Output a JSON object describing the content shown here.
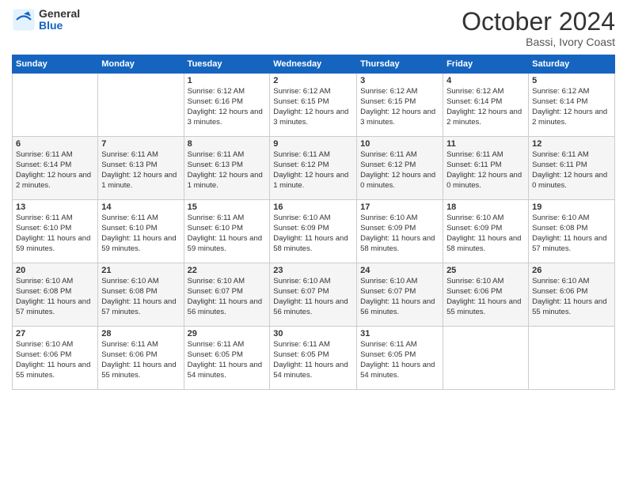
{
  "header": {
    "logo_general": "General",
    "logo_blue": "Blue",
    "title": "October 2024",
    "location": "Bassi, Ivory Coast"
  },
  "days_of_week": [
    "Sunday",
    "Monday",
    "Tuesday",
    "Wednesday",
    "Thursday",
    "Friday",
    "Saturday"
  ],
  "weeks": [
    [
      {
        "day": "",
        "info": ""
      },
      {
        "day": "",
        "info": ""
      },
      {
        "day": "1",
        "info": "Sunrise: 6:12 AM\nSunset: 6:16 PM\nDaylight: 12 hours and 3 minutes."
      },
      {
        "day": "2",
        "info": "Sunrise: 6:12 AM\nSunset: 6:15 PM\nDaylight: 12 hours and 3 minutes."
      },
      {
        "day": "3",
        "info": "Sunrise: 6:12 AM\nSunset: 6:15 PM\nDaylight: 12 hours and 3 minutes."
      },
      {
        "day": "4",
        "info": "Sunrise: 6:12 AM\nSunset: 6:14 PM\nDaylight: 12 hours and 2 minutes."
      },
      {
        "day": "5",
        "info": "Sunrise: 6:12 AM\nSunset: 6:14 PM\nDaylight: 12 hours and 2 minutes."
      }
    ],
    [
      {
        "day": "6",
        "info": "Sunrise: 6:11 AM\nSunset: 6:14 PM\nDaylight: 12 hours and 2 minutes."
      },
      {
        "day": "7",
        "info": "Sunrise: 6:11 AM\nSunset: 6:13 PM\nDaylight: 12 hours and 1 minute."
      },
      {
        "day": "8",
        "info": "Sunrise: 6:11 AM\nSunset: 6:13 PM\nDaylight: 12 hours and 1 minute."
      },
      {
        "day": "9",
        "info": "Sunrise: 6:11 AM\nSunset: 6:12 PM\nDaylight: 12 hours and 1 minute."
      },
      {
        "day": "10",
        "info": "Sunrise: 6:11 AM\nSunset: 6:12 PM\nDaylight: 12 hours and 0 minutes."
      },
      {
        "day": "11",
        "info": "Sunrise: 6:11 AM\nSunset: 6:11 PM\nDaylight: 12 hours and 0 minutes."
      },
      {
        "day": "12",
        "info": "Sunrise: 6:11 AM\nSunset: 6:11 PM\nDaylight: 12 hours and 0 minutes."
      }
    ],
    [
      {
        "day": "13",
        "info": "Sunrise: 6:11 AM\nSunset: 6:10 PM\nDaylight: 11 hours and 59 minutes."
      },
      {
        "day": "14",
        "info": "Sunrise: 6:11 AM\nSunset: 6:10 PM\nDaylight: 11 hours and 59 minutes."
      },
      {
        "day": "15",
        "info": "Sunrise: 6:11 AM\nSunset: 6:10 PM\nDaylight: 11 hours and 59 minutes."
      },
      {
        "day": "16",
        "info": "Sunrise: 6:10 AM\nSunset: 6:09 PM\nDaylight: 11 hours and 58 minutes."
      },
      {
        "day": "17",
        "info": "Sunrise: 6:10 AM\nSunset: 6:09 PM\nDaylight: 11 hours and 58 minutes."
      },
      {
        "day": "18",
        "info": "Sunrise: 6:10 AM\nSunset: 6:09 PM\nDaylight: 11 hours and 58 minutes."
      },
      {
        "day": "19",
        "info": "Sunrise: 6:10 AM\nSunset: 6:08 PM\nDaylight: 11 hours and 57 minutes."
      }
    ],
    [
      {
        "day": "20",
        "info": "Sunrise: 6:10 AM\nSunset: 6:08 PM\nDaylight: 11 hours and 57 minutes."
      },
      {
        "day": "21",
        "info": "Sunrise: 6:10 AM\nSunset: 6:08 PM\nDaylight: 11 hours and 57 minutes."
      },
      {
        "day": "22",
        "info": "Sunrise: 6:10 AM\nSunset: 6:07 PM\nDaylight: 11 hours and 56 minutes."
      },
      {
        "day": "23",
        "info": "Sunrise: 6:10 AM\nSunset: 6:07 PM\nDaylight: 11 hours and 56 minutes."
      },
      {
        "day": "24",
        "info": "Sunrise: 6:10 AM\nSunset: 6:07 PM\nDaylight: 11 hours and 56 minutes."
      },
      {
        "day": "25",
        "info": "Sunrise: 6:10 AM\nSunset: 6:06 PM\nDaylight: 11 hours and 55 minutes."
      },
      {
        "day": "26",
        "info": "Sunrise: 6:10 AM\nSunset: 6:06 PM\nDaylight: 11 hours and 55 minutes."
      }
    ],
    [
      {
        "day": "27",
        "info": "Sunrise: 6:10 AM\nSunset: 6:06 PM\nDaylight: 11 hours and 55 minutes."
      },
      {
        "day": "28",
        "info": "Sunrise: 6:11 AM\nSunset: 6:06 PM\nDaylight: 11 hours and 55 minutes."
      },
      {
        "day": "29",
        "info": "Sunrise: 6:11 AM\nSunset: 6:05 PM\nDaylight: 11 hours and 54 minutes."
      },
      {
        "day": "30",
        "info": "Sunrise: 6:11 AM\nSunset: 6:05 PM\nDaylight: 11 hours and 54 minutes."
      },
      {
        "day": "31",
        "info": "Sunrise: 6:11 AM\nSunset: 6:05 PM\nDaylight: 11 hours and 54 minutes."
      },
      {
        "day": "",
        "info": ""
      },
      {
        "day": "",
        "info": ""
      }
    ]
  ]
}
